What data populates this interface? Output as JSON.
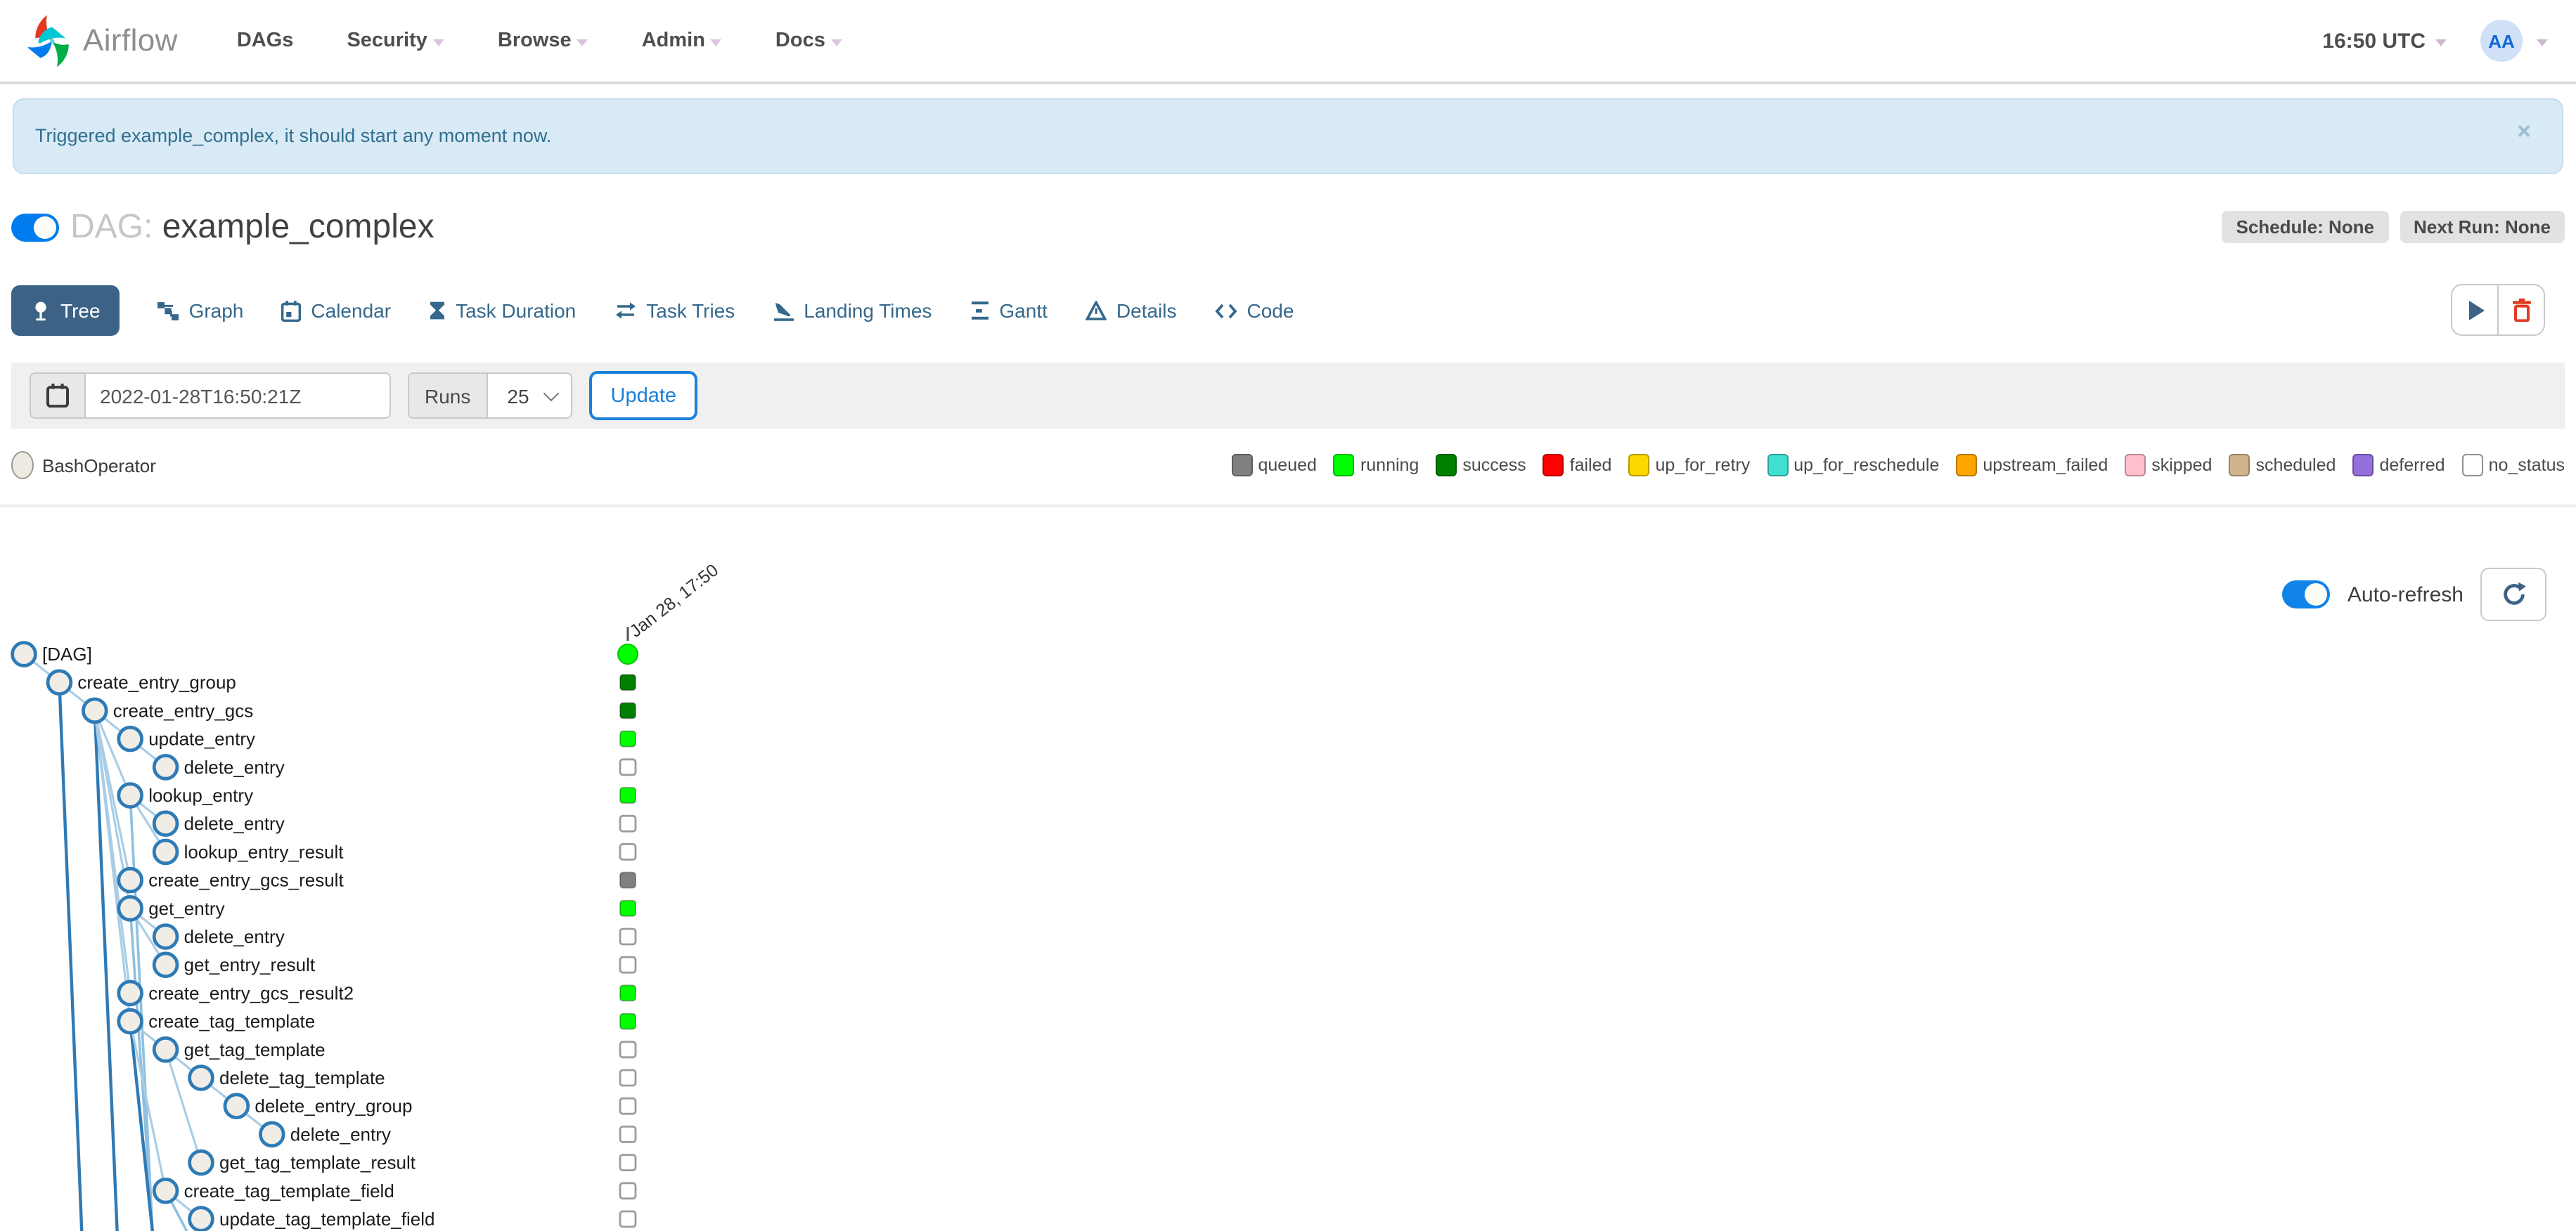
{
  "navbar": {
    "brand": "Airflow",
    "items": [
      {
        "label": "DAGs",
        "caret": false
      },
      {
        "label": "Security",
        "caret": true
      },
      {
        "label": "Browse",
        "caret": true
      },
      {
        "label": "Admin",
        "caret": true
      },
      {
        "label": "Docs",
        "caret": true
      }
    ],
    "clock": "16:50 UTC",
    "avatar_initials": "AA"
  },
  "alert": {
    "message": "Triggered example_complex, it should start any moment now.",
    "close_label": "×"
  },
  "dag_header": {
    "prefix": "DAG:",
    "name": "example_complex",
    "badges": [
      {
        "label": "Schedule: None"
      },
      {
        "label": "Next Run: None"
      }
    ]
  },
  "tabs": [
    {
      "label": "Tree",
      "active": true
    },
    {
      "label": "Graph",
      "active": false
    },
    {
      "label": "Calendar",
      "active": false
    },
    {
      "label": "Task Duration",
      "active": false
    },
    {
      "label": "Task Tries",
      "active": false
    },
    {
      "label": "Landing Times",
      "active": false
    },
    {
      "label": "Gantt",
      "active": false
    },
    {
      "label": "Details",
      "active": false
    },
    {
      "label": "Code",
      "active": false
    }
  ],
  "filter": {
    "date_value": "2022-01-28T16:50:21Z",
    "runs_label": "Runs",
    "runs_value": "25",
    "update_label": "Update"
  },
  "legend": {
    "operator": {
      "label": "BashOperator",
      "fill": "#EEEAE2",
      "stroke": "#9A9A93"
    },
    "statuses": [
      {
        "label": "queued",
        "color": "#808080"
      },
      {
        "label": "running",
        "color": "#01FF00"
      },
      {
        "label": "success",
        "color": "#008000"
      },
      {
        "label": "failed",
        "color": "#FF0000"
      },
      {
        "label": "up_for_retry",
        "color": "#FFD700"
      },
      {
        "label": "up_for_reschedule",
        "color": "#40E0D0"
      },
      {
        "label": "upstream_failed",
        "color": "#FFA500"
      },
      {
        "label": "skipped",
        "color": "#FFC0CB"
      },
      {
        "label": "scheduled",
        "color": "#D2B48C"
      },
      {
        "label": "deferred",
        "color": "#9370DB"
      },
      {
        "label": "no_status",
        "color": "#FFFFFF"
      }
    ]
  },
  "toolbar": {
    "auto_refresh_label": "Auto-refresh"
  },
  "tree": {
    "run_date_label": "Jan 28, 17:50",
    "run_status": "running",
    "rows": [
      {
        "label": "[DAG]",
        "level": 0,
        "parent": null,
        "status": "running"
      },
      {
        "label": "create_entry_group",
        "level": 1,
        "parent": 0,
        "status": "success"
      },
      {
        "label": "create_entry_gcs",
        "level": 2,
        "parent": 1,
        "status": "success"
      },
      {
        "label": "update_entry",
        "level": 3,
        "parent": 2,
        "status": "running"
      },
      {
        "label": "delete_entry",
        "level": 4,
        "parent": 3,
        "status": "no_status"
      },
      {
        "label": "lookup_entry",
        "level": 3,
        "parent": 2,
        "status": "running"
      },
      {
        "label": "delete_entry",
        "level": 4,
        "parent": 5,
        "status": "no_status"
      },
      {
        "label": "lookup_entry_result",
        "level": 4,
        "parent": 5,
        "status": "no_status"
      },
      {
        "label": "create_entry_gcs_result",
        "level": 3,
        "parent": 2,
        "status": "queued"
      },
      {
        "label": "get_entry",
        "level": 3,
        "parent": 2,
        "status": "running"
      },
      {
        "label": "delete_entry",
        "level": 4,
        "parent": 9,
        "status": "no_status"
      },
      {
        "label": "get_entry_result",
        "level": 4,
        "parent": 9,
        "status": "no_status"
      },
      {
        "label": "create_entry_gcs_result2",
        "level": 3,
        "parent": 2,
        "status": "running"
      },
      {
        "label": "create_tag_template",
        "level": 3,
        "parent": 2,
        "status": "running"
      },
      {
        "label": "get_tag_template",
        "level": 4,
        "parent": 13,
        "status": "no_status"
      },
      {
        "label": "delete_tag_template",
        "level": 5,
        "parent": 14,
        "status": "no_status"
      },
      {
        "label": "delete_entry_group",
        "level": 6,
        "parent": 15,
        "status": "no_status"
      },
      {
        "label": "delete_entry",
        "level": 7,
        "parent": 16,
        "status": "no_status"
      },
      {
        "label": "get_tag_template_result",
        "level": 5,
        "parent": 14,
        "status": "no_status"
      },
      {
        "label": "create_tag_template_field",
        "level": 4,
        "parent": 13,
        "status": "no_status"
      },
      {
        "label": "update_tag_template_field",
        "level": 5,
        "parent": 19,
        "status": "no_status"
      }
    ],
    "long_edges": [
      {
        "from": 1,
        "dark": true
      },
      {
        "from": 2,
        "dark": true
      },
      {
        "from": 5,
        "dark": false
      },
      {
        "from": 9,
        "dark": false
      },
      {
        "from": 13,
        "dark": true
      },
      {
        "from": 19,
        "dark": false
      }
    ]
  },
  "colors": {
    "brand_blue": "#017CEE",
    "tab_active_bg": "#3C6286",
    "link_blue": "#35688C",
    "update_blue": "#1A80D9",
    "alert_bg": "#D8EAF5",
    "alert_text": "#31708F",
    "delete_red": "#E03B24",
    "node_stroke": "#2E7BB6",
    "node_fill": "#F0ECE6",
    "edge_light": "#A9CDE6",
    "edge_dark": "#2F7AB5"
  }
}
